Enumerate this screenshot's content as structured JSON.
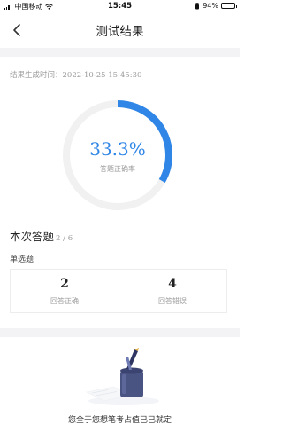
{
  "status_bar": {
    "carrier": "中国移动",
    "time": "15:45",
    "battery": "94%",
    "battery_level": 0.94
  },
  "nav": {
    "title": "测试结果"
  },
  "result": {
    "generated_label": "结果生成时间：",
    "generated_time": "2022-10-25 15:45:30",
    "rate_value": "33.3%",
    "rate_fraction": 0.333,
    "rate_label": "答题正确率"
  },
  "answers": {
    "title": "本次答题",
    "count": "2 / 6",
    "question_type": "单选题",
    "correct_count": "2",
    "correct_label": "回答正确",
    "wrong_count": "4",
    "wrong_label": "回答错误"
  },
  "footer": {
    "text": "您全于您想笔考占值已已就定"
  },
  "colors": {
    "accent": "#2f86e6",
    "ring_track": "#f1f1f1",
    "divider": "#f3f3f5"
  }
}
